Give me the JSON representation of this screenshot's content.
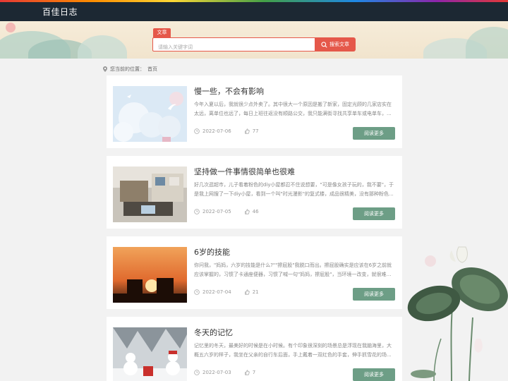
{
  "header": {
    "brand": "百佳日志"
  },
  "search": {
    "tag": "文章",
    "placeholder": "请输入关键字词",
    "button": "搜索文章"
  },
  "breadcrumb": {
    "label": "您当前的位置：",
    "home": "首页"
  },
  "posts": [
    {
      "title": "慢一些，不会有影响",
      "excerpt": "今年入夏以后，我就很少点外卖了。其中很大一个原因是搬了新家，固定光顾的几家店实在太远，离单位也远了，每日上班往返没有顺路公交，我只能满街寻找共享单车或电单车，...",
      "date": "2022-07-06",
      "likes": "77",
      "more": "阅读更多"
    },
    {
      "title": "坚持做一件事情很简单也很难",
      "excerpt": "好几次逛超市，儿子看着粉色的diy小屋都忍不住说想要，\"可是像女孩子玩的，我不要\"，于是我上网搜了一下diy小屋，看到一个叫\"时光漫影\"的复式楼，成品很精美，没有那种粉色...",
      "date": "2022-07-05",
      "likes": "46",
      "more": "阅读更多"
    },
    {
      "title": "6岁的技能",
      "excerpt": "你问我，\"妈妈，六岁的技能是什么?\"\"擦屁股\"我脱口而出。擦屁股确实是应该在6岁之前就应该掌握的，习惯了卡通座便器，习惯了喊一句\"妈妈，擦屁股\"，当环境一改变，就很难去独...",
      "date": "2022-07-04",
      "likes": "21",
      "more": "阅读更多"
    },
    {
      "title": "冬天的记忆",
      "excerpt": "记忆里的冬天，最美好的时候是在小时候。有个印象很深刻的场景总是浮现在我脑海里，大概五六岁的样子，我坐在父亲的自行车后面，手上戴着一双红色的手套，伸手抓雪花的场...",
      "date": "2022-07-03",
      "likes": "7",
      "more": "阅读更多"
    }
  ],
  "colors": {
    "accent": "#e5584a",
    "button": "#6d9e86",
    "header": "#1c2833"
  }
}
